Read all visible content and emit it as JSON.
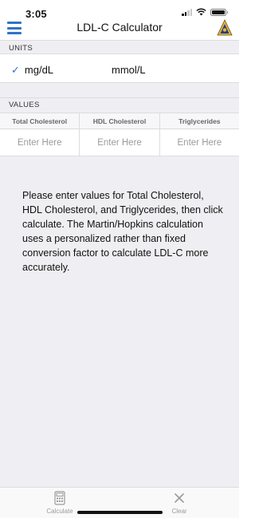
{
  "status_bar": {
    "time": "3:05"
  },
  "nav": {
    "title": "LDL-C Calculator"
  },
  "units": {
    "header": "UNITS",
    "options": [
      {
        "label": "mg/dL",
        "selected": true
      },
      {
        "label": "mmol/L",
        "selected": false
      }
    ]
  },
  "values": {
    "header": "VALUES",
    "columns": [
      {
        "header": "Total Cholesterol",
        "placeholder": "Enter Here",
        "value": ""
      },
      {
        "header": "HDL Cholesterol",
        "placeholder": "Enter Here",
        "value": ""
      },
      {
        "header": "Triglycerides",
        "placeholder": "Enter Here",
        "value": ""
      }
    ]
  },
  "instructions": "Please enter values for Total Cholesterol, HDL Cholesterol, and Triglycerides, then click calculate. The Martin/Hopkins calculation uses a personalized rather than fixed conversion factor to calculate LDL-C more accurately.",
  "tab_bar": {
    "calculate_label": "Calculate",
    "clear_label": "Clear"
  },
  "colors": {
    "accent": "#2f73c7",
    "section_background": "#efeff3",
    "placeholder": "#9b9b9b"
  },
  "icons": {
    "menu": "hamburger-menu-icon",
    "logo": "hopkins-shield-logo-icon",
    "selected": "checkmark-icon",
    "calculate": "calculator-icon",
    "clear": "close-x-icon"
  }
}
